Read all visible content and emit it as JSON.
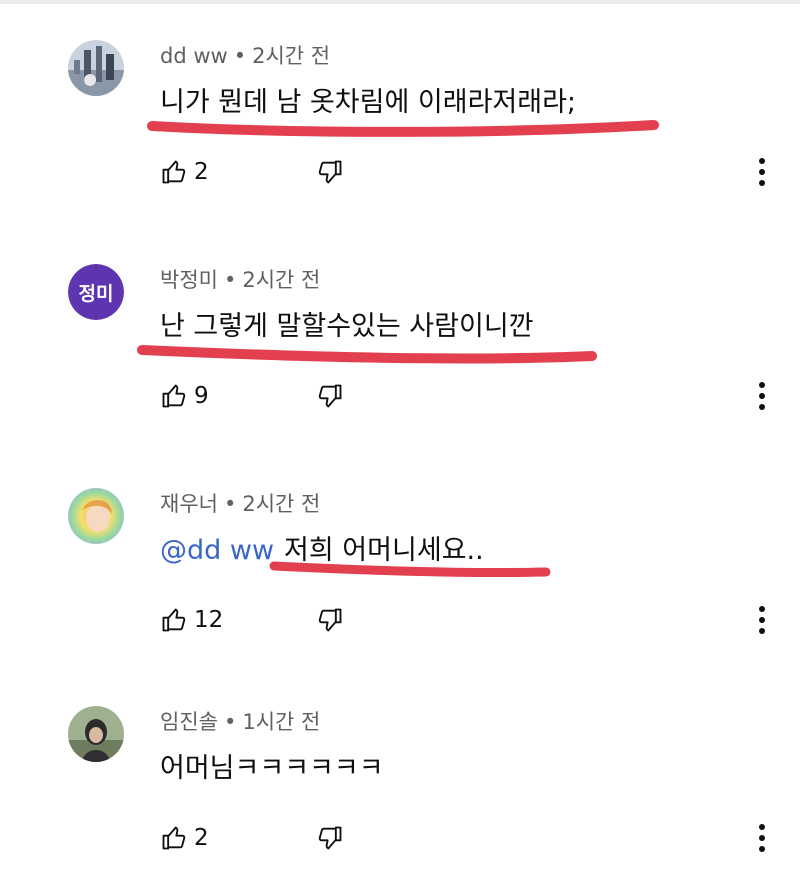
{
  "comments": [
    {
      "author": "dd ww",
      "time": "2시간 전",
      "text": "니가 뭔데 남 옷차림에 이래라저래라;",
      "likes": "2",
      "avatar_icon": "photo-avatar-icon"
    },
    {
      "author": "박정미",
      "time": "2시간 전",
      "text": "난 그렇게 말할수있는 사람이니깐",
      "likes": "9",
      "avatar_text": "정미"
    },
    {
      "author": "재우너",
      "time": "2시간 전",
      "mention": "@dd ww",
      "text": "저희 어머니세요..",
      "likes": "12",
      "avatar_icon": "photo-avatar-icon"
    },
    {
      "author": "임진솔",
      "time": "1시간 전",
      "text": "어머님ㅋㅋㅋㅋㅋㅋ",
      "likes": "2",
      "avatar_icon": "photo-avatar-icon"
    }
  ],
  "colors": {
    "underline": "#e2404e",
    "avatar_purple": "#5e35b1",
    "mention": "#3867c8",
    "meta_text": "#606060"
  },
  "icons": {
    "like": "thumbs-up-icon",
    "dislike": "thumbs-down-icon",
    "more": "more-vertical-icon"
  }
}
